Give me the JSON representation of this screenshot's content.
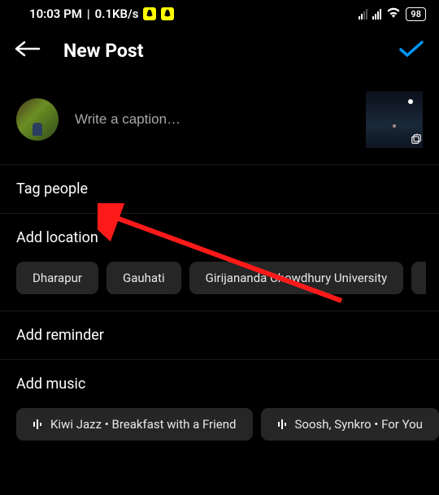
{
  "status": {
    "time": "10:03 PM",
    "speed": "0.1KB/s",
    "battery": "98"
  },
  "header": {
    "title": "New Post"
  },
  "caption": {
    "placeholder": "Write a caption…"
  },
  "rows": {
    "tag_people": "Tag people",
    "add_location": "Add location",
    "add_reminder": "Add reminder",
    "add_music": "Add music"
  },
  "location_chips": [
    "Dharapur",
    "Gauhati",
    "Girijananda Chowdhury University"
  ],
  "music_chips": [
    "Kiwi Jazz • Breakfast with a Friend",
    "Soosh, Synkro • For You"
  ]
}
